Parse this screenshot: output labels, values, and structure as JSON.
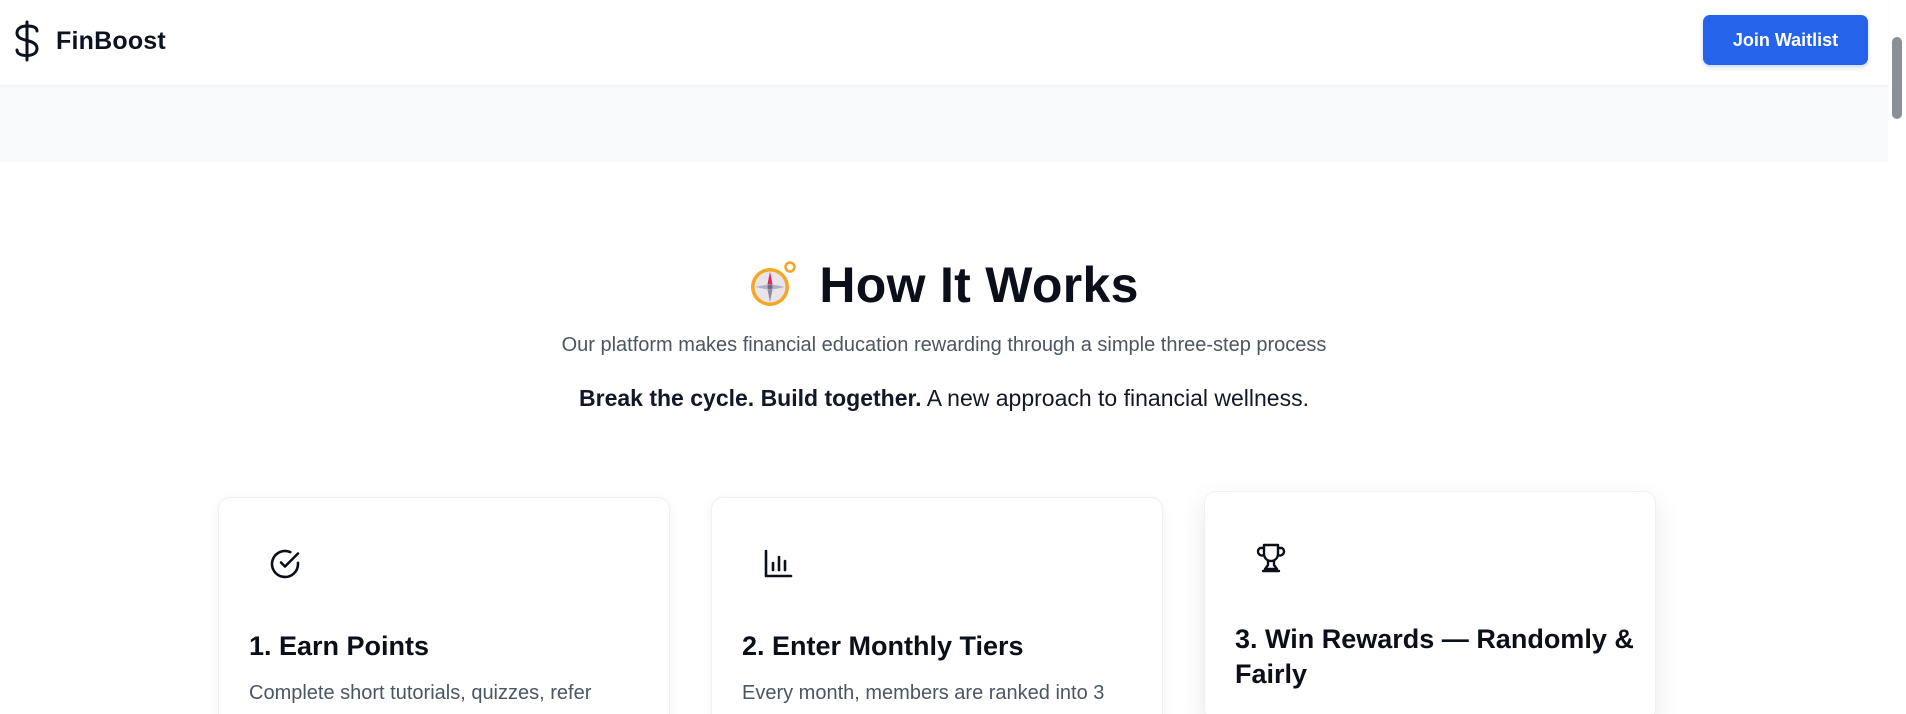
{
  "header": {
    "brand_icon": "dollar-icon",
    "brand_name": "FinBoost",
    "cta_label": "Join Waitlist",
    "accent_color": "#2563eb"
  },
  "section": {
    "title_icon": "compass-icon",
    "title": "How It Works",
    "subtitle": "Our platform makes financial education rewarding through a simple three-step process",
    "tagline_bold": "Break the cycle. Build together.",
    "tagline_rest": " A new approach to financial wellness."
  },
  "cards": [
    {
      "icon": "check-circle-icon",
      "title": "1. Earn Points",
      "description": "Complete short tutorials, quizzes, refer"
    },
    {
      "icon": "bar-chart-icon",
      "title": "2. Enter Monthly Tiers",
      "description": "Every month, members are ranked into 3"
    },
    {
      "icon": "trophy-icon",
      "title": "3. Win Rewards — Randomly & Fairly",
      "description": ""
    }
  ]
}
